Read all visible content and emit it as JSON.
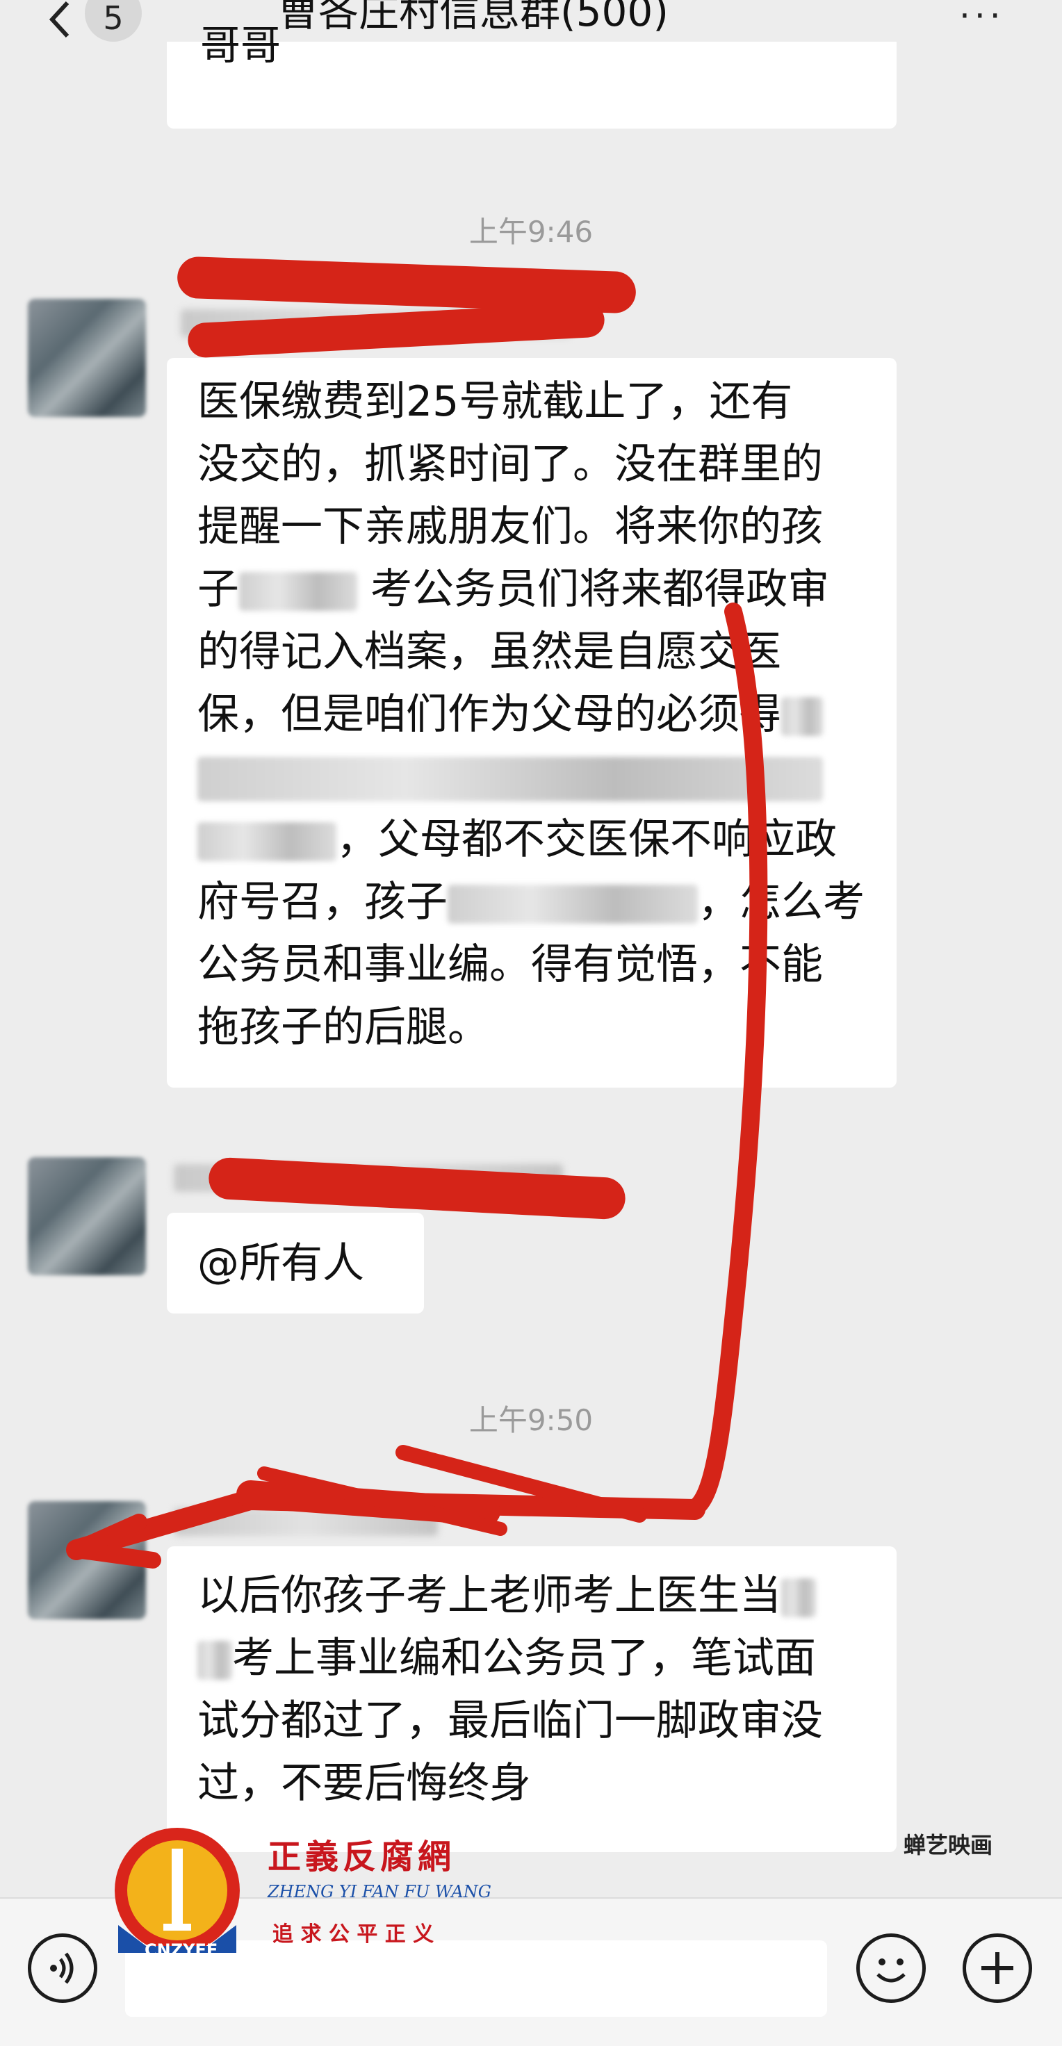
{
  "header": {
    "unread_count": "5",
    "title": "曹各庄村信息群(500)",
    "more_label": "···"
  },
  "messages": {
    "prev_fragment": "哥哥",
    "time1": "上午9:46",
    "msg1_lines": [
      "医保缴费到25号就截止了，还有",
      "没交的，抓紧时间了。没在群里的",
      "提醒一下亲戚朋友们。将来你的孩",
      "考公务员们将来都得政审",
      "的得记入档案，虽然是自愿交医",
      "保，但是咱们作为父母的必须得",
      "，父母都不交医保不响应政",
      "府号召，孩子",
      "，怎么考",
      "公务员和事业编。得有觉悟，不能",
      "拖孩子的后腿。"
    ],
    "msg1_child": "子",
    "msg2": "@所有人",
    "time2": "上午9:50",
    "msg3_lines": [
      "以后你孩子考上老师考上医生当",
      "考上事业编和公务员了，笔试面",
      "试分都过了，最后临门一脚政审没",
      "过，不要后悔终身"
    ]
  },
  "watermark": {
    "cn_name": "正義反腐網",
    "pinyin": "ZHENG YI FAN FU WANG",
    "slogan": "追 求 公 平 正 义",
    "badge": "CNZYFF",
    "corner_mark": "蝉艺映画"
  },
  "icons": {
    "back": "chevron-left-icon",
    "voice": "voice-icon",
    "emoji": "emoji-icon",
    "plus": "plus-icon"
  },
  "colors": {
    "background": "#ededed",
    "bubble": "#ffffff",
    "annotation_red": "#d52418",
    "watermark_red": "#c8161d"
  }
}
